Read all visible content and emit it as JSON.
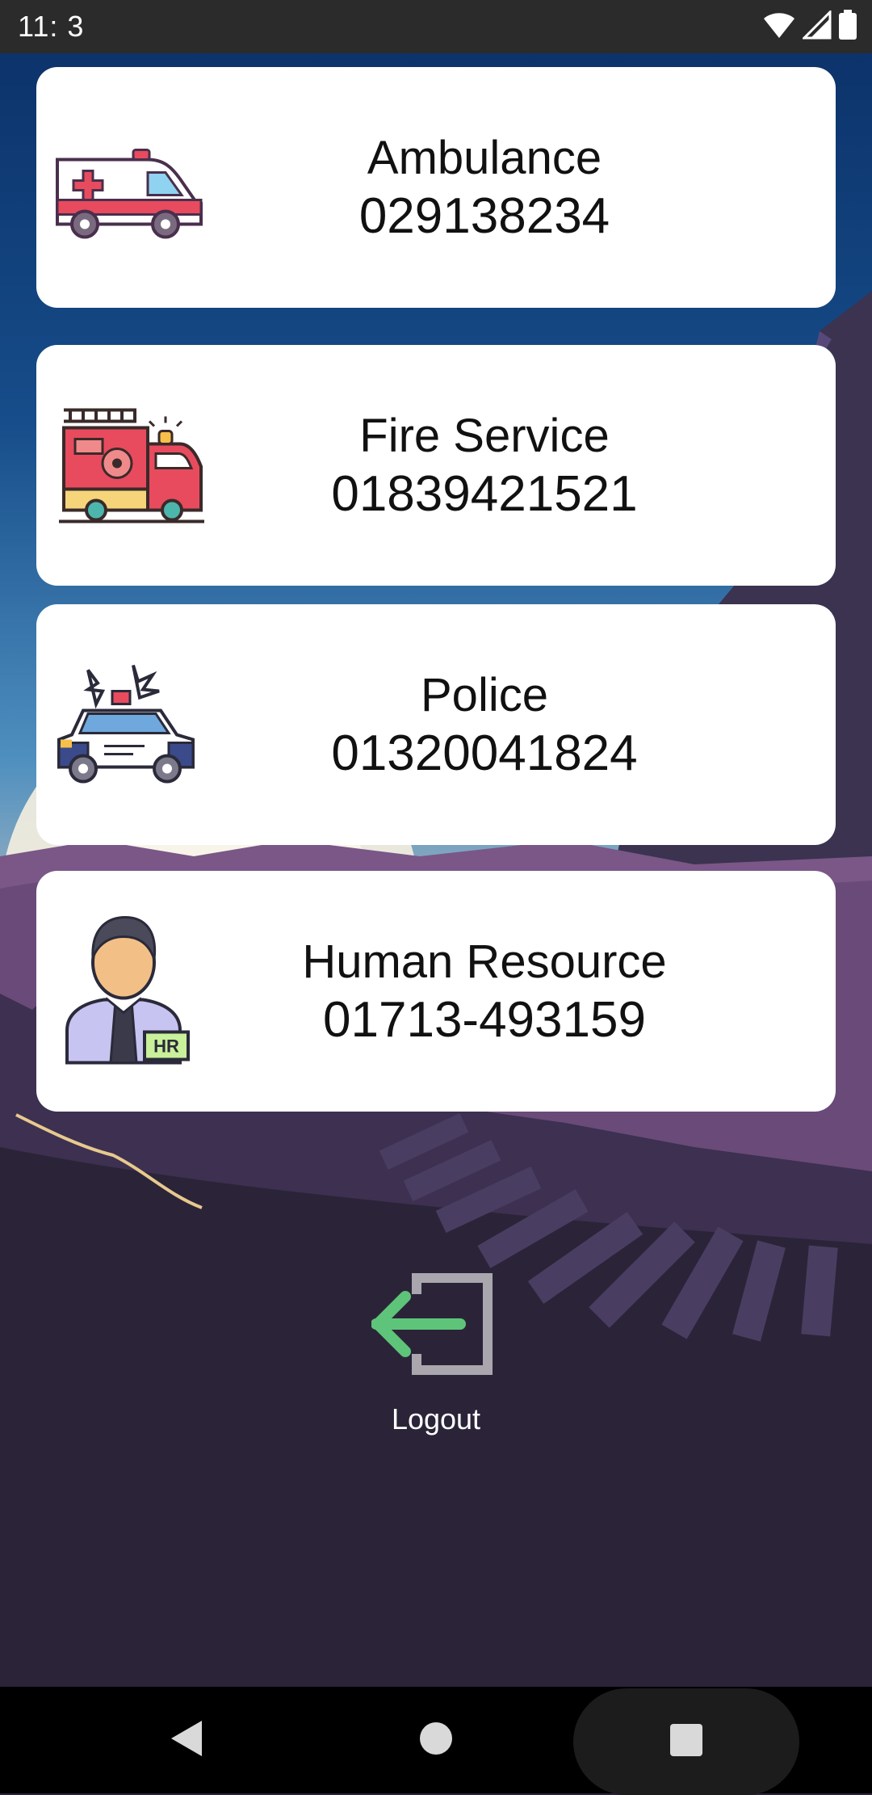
{
  "status_bar": {
    "time": "11:  3",
    "icons": [
      "wifi-icon",
      "signal-icon",
      "battery-icon"
    ]
  },
  "contacts": [
    {
      "label": "Ambulance",
      "number": "029138234",
      "icon": "ambulance-icon"
    },
    {
      "label": "Fire Service",
      "number": "01839421521",
      "icon": "fire-truck-icon"
    },
    {
      "label": "Police",
      "number": "01320041824",
      "icon": "police-car-icon"
    },
    {
      "label": "Human Resource",
      "number": "01713-493159",
      "icon": "hr-person-icon"
    }
  ],
  "logout": {
    "label": "Logout",
    "icon": "logout-arrow-icon",
    "icon_color": "#5ec47a"
  },
  "nav_bar": {
    "buttons": [
      "back-icon",
      "home-icon",
      "recents-icon"
    ]
  },
  "colors": {
    "background": "#2b2438",
    "card": "#ffffff",
    "text": "#111111"
  }
}
